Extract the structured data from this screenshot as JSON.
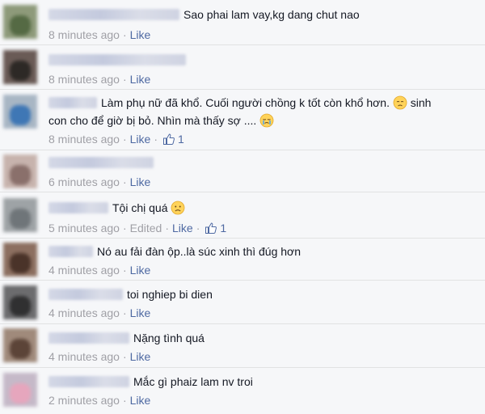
{
  "comments": [
    {
      "text": "Sao phai lam vay,kg dang chut nao",
      "time": "8 minutes ago",
      "like": "Like",
      "colors": [
        "#8e9a7a",
        "#556a44"
      ]
    },
    {
      "text": "",
      "time": "8 minutes ago",
      "like": "Like",
      "colors": [
        "#6a5b56",
        "#2d2926"
      ]
    },
    {
      "text_line1": "Làm phụ nữ đã khổ. Cuối người chồng k tốt còn khổ hơn.",
      "text_line1_tail": "sinh",
      "text_line2": "con cho để giờ bị bỏ. Nhìn mà thấy sợ ....",
      "time": "8 minutes ago",
      "like": "Like",
      "likes": "1",
      "colors": [
        "#a8b6c4",
        "#3f77b5"
      ]
    },
    {
      "text": "",
      "time": "6 minutes ago",
      "like": "Like",
      "colors": [
        "#c7b3ad",
        "#8a706b"
      ]
    },
    {
      "text": "Tội chị quá",
      "time": "5 minutes ago",
      "edited": "Edited",
      "like": "Like",
      "likes": "1",
      "colors": [
        "#9ea3a6",
        "#6f7579"
      ]
    },
    {
      "text": "Nó au fải đàn ộp..là súc xinh thì đúg hơn",
      "time": "4 minutes ago",
      "like": "Like",
      "colors": [
        "#8c6f60",
        "#4a3329"
      ]
    },
    {
      "text": "toi nghiep bi dien",
      "time": "4 minutes ago",
      "like": "Like",
      "colors": [
        "#6c6c6e",
        "#303031"
      ]
    },
    {
      "text": "Nặng tình quá",
      "time": "4 minutes ago",
      "like": "Like",
      "colors": [
        "#a08a7b",
        "#5c4438"
      ]
    },
    {
      "text": "Mắc gì phaiz lam nv troi",
      "time": "2 minutes ago",
      "like": "Like",
      "colors": [
        "#c5b9c8",
        "#e6a6bd"
      ]
    }
  ],
  "icons": {
    "sad_emoji": "disappointed-face",
    "cry_emoji": "crying-face",
    "frown_emoji": "frowning-face",
    "like_thumb": "thumbs-up"
  },
  "colors": {
    "link": "#4e69a2",
    "meta": "#a0a0a6",
    "text": "#141823",
    "background": "#f6f7f9"
  }
}
